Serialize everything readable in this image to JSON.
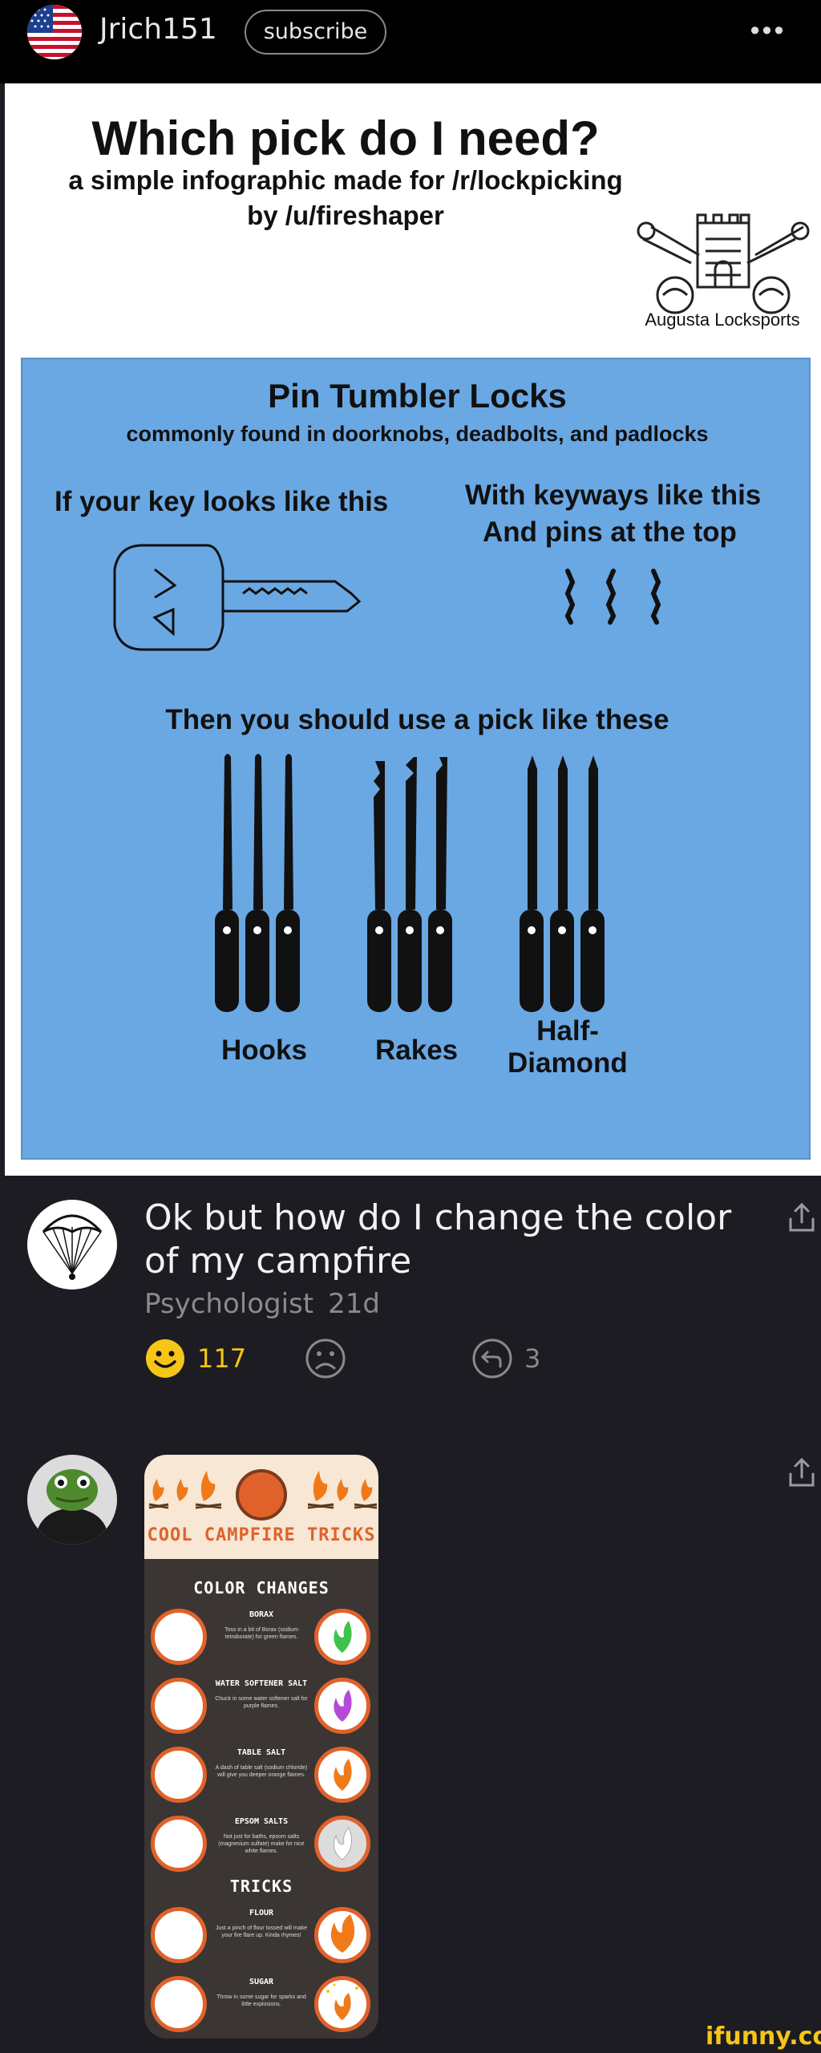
{
  "post": {
    "username": "Jrich151",
    "subscribe_label": "subscribe",
    "more_label": "•••"
  },
  "infographic": {
    "title": "Which pick do I need?",
    "subtitle1": "a simple infographic made for /r/lockpicking",
    "subtitle2": "by /u/fireshaper",
    "crest_label": "Augusta Locksports",
    "panel_title": "Pin Tumbler Locks",
    "panel_subtitle": "commonly found in doorknobs, deadbolts, and padlocks",
    "key_label": "If your key looks like this",
    "keyway_label1": "With keyways like this",
    "keyway_label2": "And pins at the top",
    "use_label": "Then you should use a pick like these",
    "picks": [
      "Hooks",
      "Rakes",
      "Half-",
      "Diamond"
    ]
  },
  "comments": [
    {
      "text": "Ok but how do I change the color of my campfire",
      "author": "Psychologist",
      "time": "21d",
      "likes": "117",
      "replies": "3",
      "avatar_icon": "parachute-icon"
    },
    {
      "avatar_icon": "frog-hoodie-avatar",
      "image": {
        "header": "COOL CAMPFIRE TRICKS",
        "section1": "COLOR CHANGES",
        "section2": "TRICKS",
        "rows": [
          {
            "name": "BORAX",
            "desc": "Toss in a bit of Borax (sodium tetraborate) for green flames.",
            "flame": "#3fc24a"
          },
          {
            "name": "WATER SOFTENER SALT",
            "desc": "Chuck in some water softener salt for purple flames.",
            "flame": "#b44ad6"
          },
          {
            "name": "TABLE SALT",
            "desc": "A dash of table salt (sodium chloride) will give you deeper orange flames.",
            "flame": "#f07a1a"
          },
          {
            "name": "EPSOM SALTS",
            "desc": "Not just for baths, epsom salts (magnesium sulfate) make for nice white flames.",
            "flame": "#f4f4f4"
          },
          {
            "name": "FLOUR",
            "desc": "Just a pinch of flour tossed will make your fire flare up. Kinda rhymes!",
            "flame": "#f07a1a"
          },
          {
            "name": "SUGAR",
            "desc": "Throw in some sugar for sparks and little explosions.",
            "flame": "#f07a1a"
          }
        ]
      }
    }
  ],
  "watermark": "ifunny.co",
  "colors": {
    "like": "#f5c518",
    "meta": "#8a8a8e",
    "panel_blue": "#6aa8e4",
    "campfire_orange": "#e0622a"
  }
}
